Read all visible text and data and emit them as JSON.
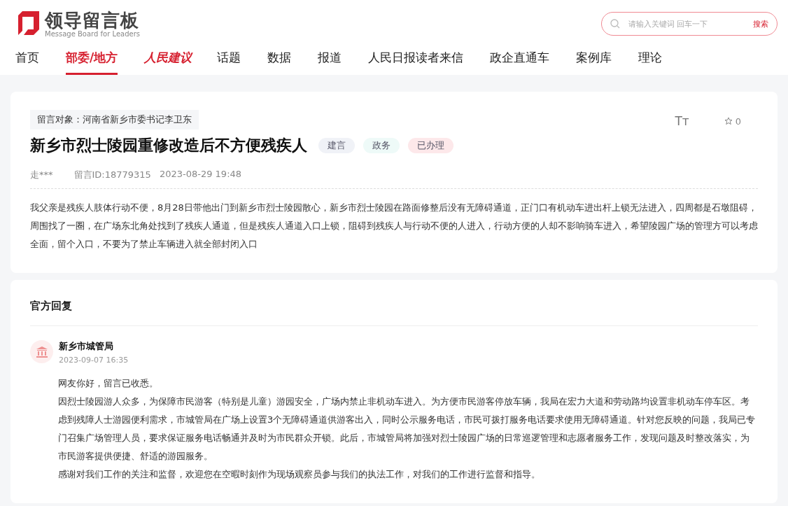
{
  "logo": {
    "title": "领导留言板",
    "subtitle": "Message Board for Leaders"
  },
  "search": {
    "placeholder": "请输入关键词 回车一下",
    "button": "搜索"
  },
  "nav": [
    {
      "label": "首页",
      "kind": "plain",
      "selected": false
    },
    {
      "label": "部委/地方",
      "kind": "plain",
      "selected": true
    },
    {
      "label": "人民建议",
      "kind": "brand",
      "selected": false
    },
    {
      "label": "话题",
      "kind": "plain",
      "selected": false
    },
    {
      "label": "数据",
      "kind": "plain",
      "selected": false
    },
    {
      "label": "报道",
      "kind": "plain",
      "selected": false
    },
    {
      "label": "人民日报读者来信",
      "kind": "plain",
      "selected": false
    },
    {
      "label": "政企直通车",
      "kind": "plain",
      "selected": false
    },
    {
      "label": "案例库",
      "kind": "plain",
      "selected": false
    },
    {
      "label": "理论",
      "kind": "plain",
      "selected": false
    }
  ],
  "message": {
    "target": "留言对象：河南省新乡市委书记李卫东",
    "title": "新乡市烈士陵园重修改造后不方便残疾人",
    "tags": [
      {
        "label": "建言",
        "color": "#f0f2f7"
      },
      {
        "label": "政务",
        "color": "#eefaf8"
      },
      {
        "label": "已办理",
        "color": "#fde8ea"
      }
    ],
    "font_size_label": "Tт",
    "favorites": "0",
    "author": "走***",
    "id": "留言ID:18779315",
    "date": "2023-08-29 19:48",
    "body": "我父亲是残疾人肢体行动不便，8月28日带他出门到新乡市烈士陵园散心，新乡市烈士陵园在路面修整后没有无障碍通道，正门口有机动车进出杆上锁无法进入，四周都是石墩阻碍，周围找了一圈，在广场东北角处找到了残疾人通道，但是残疾人通道入口上锁，阻碍到残疾人与行动不便的人进入，行动方便的人却不影响骑车进入，希望陵园广场的管理方可以考虑全面，留个入口，不要为了禁止车辆进入就全部封闭入口"
  },
  "reply": {
    "heading": "官方回复",
    "org": "新乡市城管局",
    "date": "2023-09-07 16:35",
    "paragraphs": [
      "网友你好，留言已收悉。",
      "因烈士陵园游人众多，为保障市民游客（特别是儿童）游园安全，广场内禁止非机动车进入。为方便市民游客停放车辆，我局在宏力大道和劳动路均设置非机动车停车区。考虑到残障人士游园便利需求，市城管局在广场上设置3个无障碍通道供游客出入，同时公示服务电话，市民可拨打服务电话要求使用无障碍通道。针对您反映的问题，我局已专门召集广场管理人员，要求保证服务电话畅通并及时为市民群众开锁。此后，市城管局将加强对烈士陵园广场的日常巡逻管理和志愿者服务工作，发现问题及时整改落实，为市民游客提供便捷、舒适的游园服务。",
      "感谢对我们工作的关注和监督，欢迎您在空暇时刻作为现场观察员参与我们的执法工作，对我们的工作进行监督和指导。"
    ]
  }
}
